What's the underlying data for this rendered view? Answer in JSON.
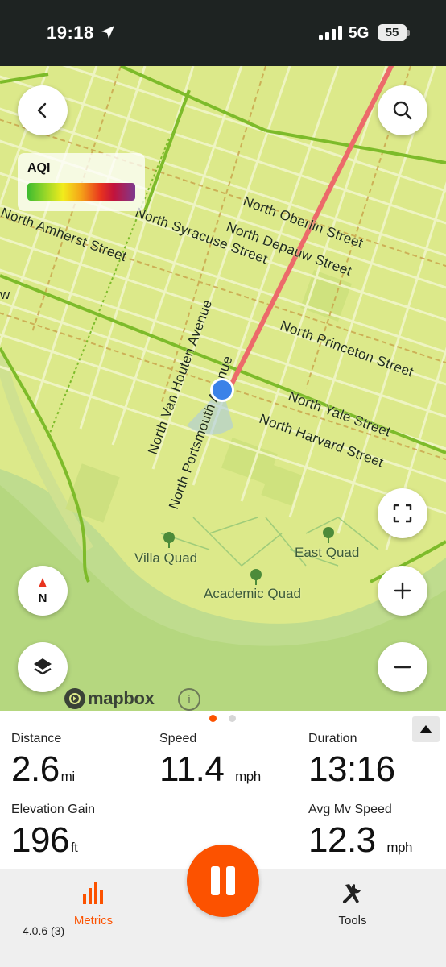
{
  "status_bar": {
    "time": "19:18",
    "network": "5G",
    "battery": "55"
  },
  "map": {
    "aqi_legend_title": "AQI",
    "attribution": "mapbox",
    "streets": [
      "North Amherst Street",
      "North Syracuse Street",
      "North Oberlin Street",
      "North Depauw Street",
      "North Van Houten Avenue",
      "North Portsmouth Avenue",
      "North Princeton Street",
      "North Yale Street",
      "North Harvard Street"
    ],
    "places": [
      "Villa Quad",
      "East Quad",
      "Academic Quad"
    ],
    "icons": [
      "back-icon",
      "search-icon",
      "fullscreen-icon",
      "compass-icon",
      "zoom-in-icon",
      "layers-icon",
      "zoom-out-icon",
      "info-icon"
    ],
    "compass_label": "N",
    "left_edge_fragment": "w"
  },
  "metrics": {
    "distance": {
      "label": "Distance",
      "value": "2.6",
      "unit": "mi"
    },
    "speed": {
      "label": "Speed",
      "value": "11.4",
      "unit": "mph"
    },
    "duration": {
      "label": "Duration",
      "value": "13:16"
    },
    "elevation_gain": {
      "label": "Elevation Gain",
      "value": "196",
      "unit": "ft"
    },
    "avg_mv_speed": {
      "label": "Avg Mv Speed",
      "value": "12.3",
      "unit": "mph"
    }
  },
  "tabs": [
    {
      "label": "Metrics",
      "icon": "bar-chart-icon",
      "active": true
    },
    {
      "label": "Tools",
      "icon": "tools-icon",
      "active": false
    }
  ],
  "version": "4.0.6 (3)",
  "colors": {
    "accent": "#fc5200",
    "map_background": "#dce98a",
    "route_line": "#ec6a6a",
    "location_dot": "#3b82e8",
    "status_bar": "#1e2322"
  }
}
